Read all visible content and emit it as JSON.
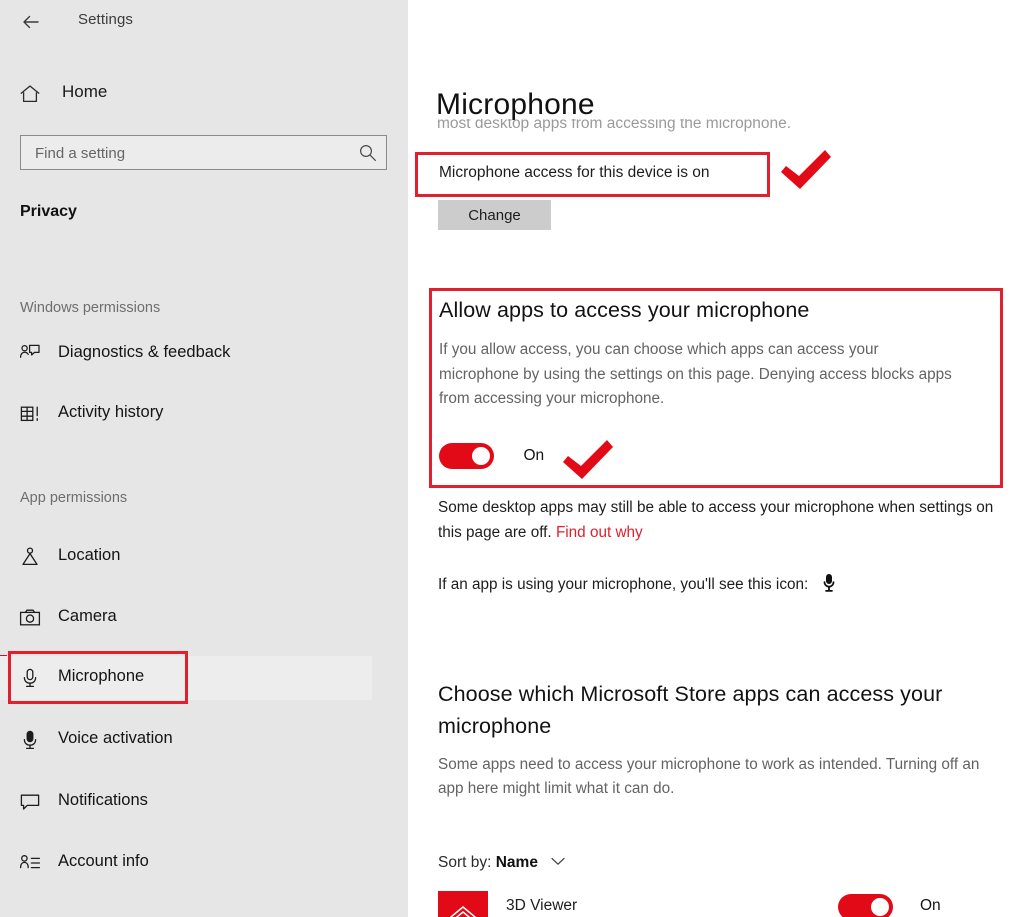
{
  "sidebar": {
    "back_icon": "back-arrow-icon",
    "title": "Settings",
    "home_label": "Home",
    "home_icon": "home-icon",
    "search": {
      "placeholder": "Find a setting",
      "value": "",
      "icon": "search-icon"
    },
    "category": "Privacy",
    "groups": [
      {
        "label": "Windows permissions",
        "items": [
          {
            "label": "Diagnostics & feedback",
            "icon": "feedback-person-icon",
            "selected": false
          },
          {
            "label": "Activity history",
            "icon": "activity-history-icon",
            "selected": false
          }
        ]
      },
      {
        "label": "App permissions",
        "items": [
          {
            "label": "Location",
            "icon": "location-pin-icon",
            "selected": false
          },
          {
            "label": "Camera",
            "icon": "camera-icon",
            "selected": false
          },
          {
            "label": "Microphone",
            "icon": "microphone-icon",
            "selected": true
          },
          {
            "label": "Voice activation",
            "icon": "voice-activation-icon",
            "selected": false
          },
          {
            "label": "Notifications",
            "icon": "notification-balloon-icon",
            "selected": false
          },
          {
            "label": "Account info",
            "icon": "account-info-icon",
            "selected": false
          }
        ]
      }
    ]
  },
  "main": {
    "title": "Microphone",
    "subtitle": "most desktop apps from accessing the microphone.",
    "device_access": {
      "status_text": "Microphone access for this device is on",
      "change_label": "Change"
    },
    "allow_apps": {
      "heading": "Allow apps to access your microphone",
      "description": "If you allow access, you can choose which apps can access your microphone by using the settings on this page. Denying access blocks apps from accessing your microphone.",
      "toggle_state": "On"
    },
    "desktop_note": {
      "text": "Some desktop apps may still be able to access your microphone when settings on this page are off. ",
      "link_label": "Find out why"
    },
    "using_mic_note": {
      "text": "If an app is using your microphone, you'll see this icon:",
      "icon": "microphone-icon"
    },
    "choose_apps": {
      "heading": "Choose which Microsoft Store apps can access your microphone",
      "description": "Some apps need to access your microphone to work as intended. Turning off an app here might limit what it can do.",
      "sort_prefix": "Sort by:",
      "sort_value": "Name",
      "sort_icon": "chevron-down-icon",
      "apps": [
        {
          "name": "3D Viewer",
          "icon": "3d-viewer-tile-icon",
          "toggle_state": "On"
        }
      ]
    }
  },
  "annotations": {
    "colors": {
      "highlight_red": "#e0202e",
      "accent_red": "#e30a17"
    },
    "boxes": [
      {
        "name": "device-access-highlight"
      },
      {
        "name": "allow-apps-highlight"
      },
      {
        "name": "microphone-nav-highlight"
      }
    ],
    "check_marks": [
      {
        "name": "device-access-check"
      },
      {
        "name": "allow-apps-toggle-check"
      }
    ]
  }
}
